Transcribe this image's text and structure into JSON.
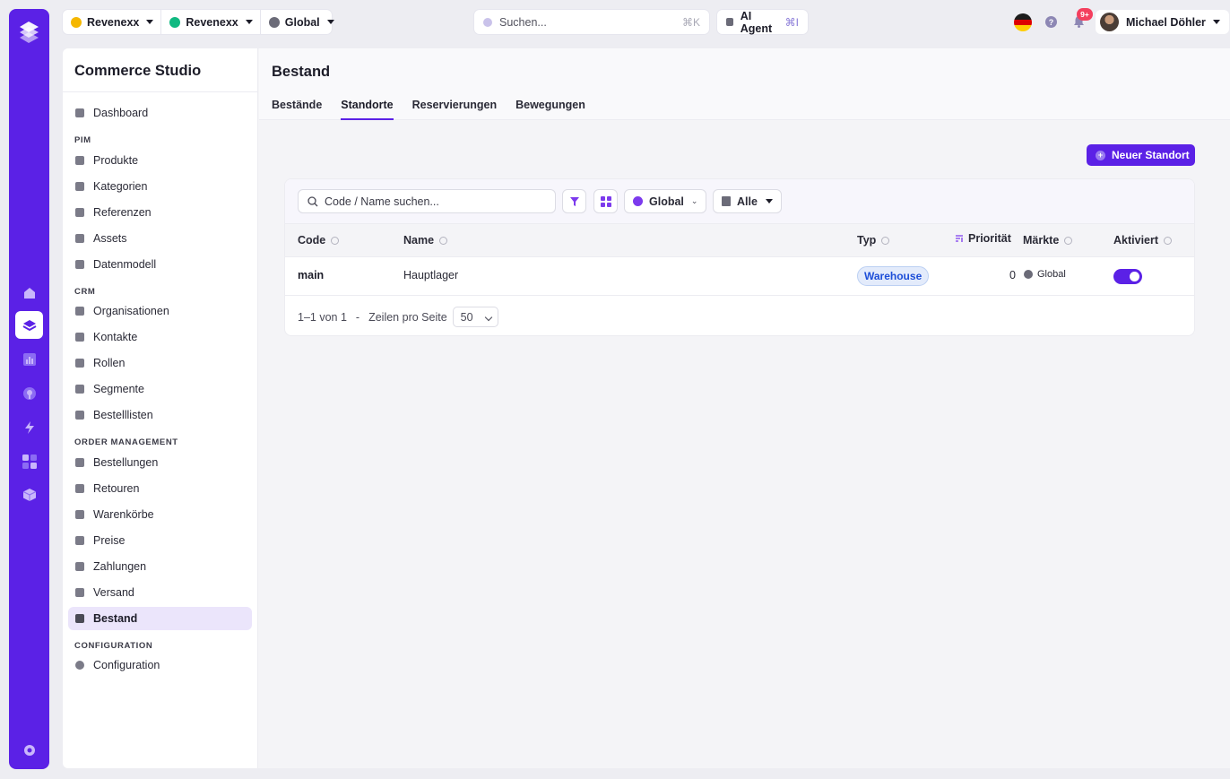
{
  "topbar": {
    "switchers": [
      {
        "label": "Revenexx",
        "color": "#f5b700"
      },
      {
        "label": "Revenexx",
        "color": "#10b981"
      },
      {
        "label": "Global",
        "color": "#6b6b78"
      }
    ],
    "search_placeholder": "Suchen...",
    "search_shortcut": "⌘K",
    "ai_agent_label": "AI Agent",
    "ai_agent_shortcut": "⌘I",
    "help_glyph": "?",
    "notification_badge": "9+",
    "user_name": "Michael Döhler",
    "language_flag": "de"
  },
  "rail": {
    "items": [
      "home-icon",
      "layers-icon",
      "chart-icon",
      "pin-icon",
      "bolt-icon",
      "apps-icon",
      "cube-icon",
      "settings-icon"
    ],
    "active": "layers-icon"
  },
  "sidebar": {
    "app_title": "Commerce Studio",
    "top_item": "Dashboard",
    "sections": [
      {
        "title": "PIM",
        "items": [
          "Produkte",
          "Kategorien",
          "Referenzen",
          "Assets",
          "Datenmodell"
        ]
      },
      {
        "title": "CRM",
        "items": [
          "Organisationen",
          "Kontakte",
          "Rollen",
          "Segmente",
          "Bestelllisten"
        ]
      },
      {
        "title": "ORDER MANAGEMENT",
        "items": [
          "Bestellungen",
          "Retouren",
          "Warenkörbe",
          "Preise",
          "Zahlungen",
          "Versand",
          "Bestand"
        ]
      },
      {
        "title": "CONFIGURATION",
        "items": [
          "Configuration"
        ]
      }
    ],
    "active_item": "Bestand"
  },
  "page": {
    "title": "Bestand",
    "tabs": [
      "Bestände",
      "Standorte",
      "Reservierungen",
      "Bewegungen"
    ],
    "active_tab": "Standorte",
    "primary_button": "Neuer Standort"
  },
  "toolbar": {
    "search_placeholder": "Code / Name suchen...",
    "market_filter": "Global",
    "status_filter": "Alle"
  },
  "table": {
    "columns": [
      "Code",
      "Name",
      "Typ",
      "Priorität",
      "Märkte",
      "Aktiviert"
    ],
    "rows": [
      {
        "code": "main",
        "name": "Hauptlager",
        "type": "Warehouse",
        "priority": "0",
        "markets": "Global",
        "enabled": true
      }
    ],
    "pagination": {
      "range": "1–1 von 1",
      "separator": "-",
      "rows_per_page_label": "Zeilen pro Seite",
      "rows_per_page": "50"
    }
  },
  "colors": {
    "accent": "#5b21e6",
    "badge_text": "#1d4ed8",
    "badge_bg": "#e3ebfb"
  }
}
